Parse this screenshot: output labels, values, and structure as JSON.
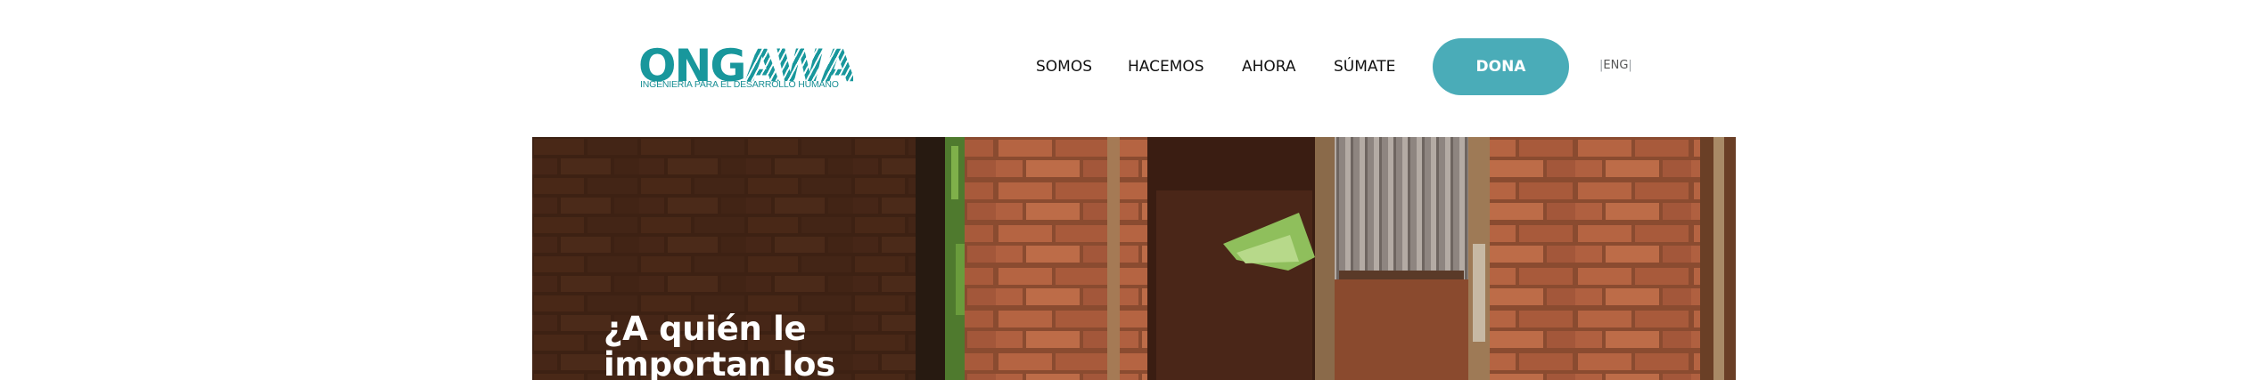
{
  "logo": {
    "main_ong": "ONG",
    "main_awa": "AWA",
    "tagline": "INGENIERÍA PARA EL DESARROLLO HUMANO"
  },
  "nav": {
    "items": [
      {
        "label": "SOMOS"
      },
      {
        "label": "HACEMOS"
      },
      {
        "label": "AHORA"
      },
      {
        "label": "SÚMATE"
      }
    ],
    "donate_label": "DONA",
    "lang_label": "ENG"
  },
  "hero": {
    "title": "¿A quién le importan los"
  },
  "colors": {
    "brand_teal": "#18979c",
    "donate_bg": "#4aacb8"
  }
}
